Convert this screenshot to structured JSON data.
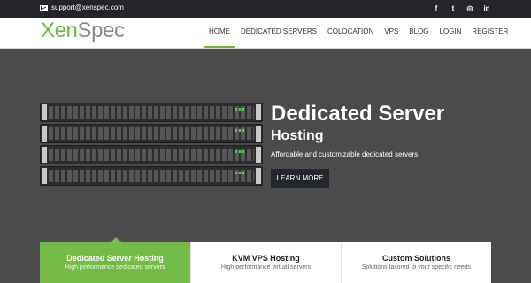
{
  "topbar": {
    "email": "support@xenspec.com",
    "social": [
      {
        "icon": "facebook-icon",
        "glyph": "f"
      },
      {
        "icon": "twitter-icon",
        "glyph": "t"
      },
      {
        "icon": "instagram-icon",
        "glyph": "◎"
      },
      {
        "icon": "linkedin-icon",
        "glyph": "in"
      }
    ]
  },
  "brand": {
    "name_part1": "Xen",
    "name_part2": "Spec",
    "color_primary": "#6fb83b",
    "color_secondary": "#8a8a8a"
  },
  "nav": {
    "items": [
      {
        "label": "HOME",
        "active": true
      },
      {
        "label": "DEDICATED SERVERS",
        "active": false
      },
      {
        "label": "COLOCATION",
        "active": false
      },
      {
        "label": "VPS",
        "active": false
      },
      {
        "label": "BLOG",
        "active": false
      },
      {
        "label": "LOGIN",
        "active": false
      },
      {
        "label": "REGISTER",
        "active": false
      }
    ]
  },
  "hero": {
    "title": "Dedicated Server",
    "subtitle": "Hosting",
    "description": "Affordable and customizable dedicated servers.",
    "button_label": "LEARN MORE",
    "background_color": "#4b4b4b"
  },
  "cards": [
    {
      "title": "Dedicated Server Hosting",
      "description": "High performance dedicated servers",
      "active": true
    },
    {
      "title": "KVM VPS Hosting",
      "description": "High performance virtual servers",
      "active": false
    },
    {
      "title": "Custom Solutions",
      "description": "Solutions tailored to your specific needs",
      "active": false
    }
  ],
  "colors": {
    "accent": "#74bc45",
    "dark": "#23262d"
  }
}
